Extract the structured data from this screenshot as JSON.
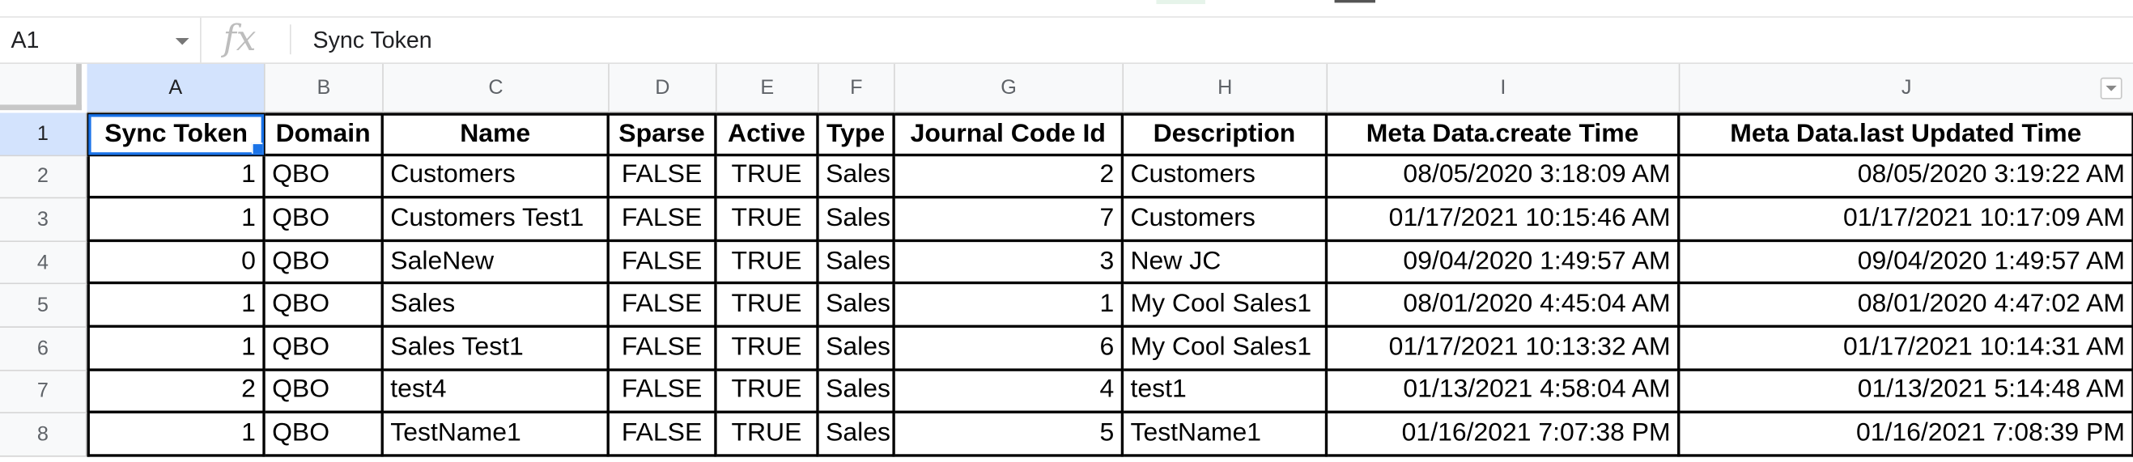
{
  "name_box": {
    "value": "A1"
  },
  "formula_bar": {
    "fx": "fx",
    "value": "Sync Token"
  },
  "columns": [
    "A",
    "B",
    "C",
    "D",
    "E",
    "F",
    "G",
    "H",
    "I",
    "J"
  ],
  "rows": [
    "1",
    "2",
    "3",
    "4",
    "5",
    "6",
    "7",
    "8"
  ],
  "table": {
    "headers": [
      "Sync Token",
      "Domain",
      "Name",
      "Sparse",
      "Active",
      "Type",
      "Journal Code Id",
      "Description",
      "Meta Data.create Time",
      "Meta Data.last Updated Time"
    ],
    "data": [
      [
        "1",
        "QBO",
        "Customers",
        "FALSE",
        "TRUE",
        "Sales",
        "2",
        "Customers",
        "08/05/2020 3:18:09 AM",
        "08/05/2020 3:19:22 AM"
      ],
      [
        "1",
        "QBO",
        "Customers Test1",
        "FALSE",
        "TRUE",
        "Sales",
        "7",
        "Customers",
        "01/17/2021 10:15:46 AM",
        "01/17/2021 10:17:09 AM"
      ],
      [
        "0",
        "QBO",
        "SaleNew",
        "FALSE",
        "TRUE",
        "Sales",
        "3",
        "New JC",
        "09/04/2020 1:49:57 AM",
        "09/04/2020 1:49:57 AM"
      ],
      [
        "1",
        "QBO",
        "Sales",
        "FALSE",
        "TRUE",
        "Sales",
        "1",
        "My Cool Sales1",
        "08/01/2020 4:45:04 AM",
        "08/01/2020 4:47:02 AM"
      ],
      [
        "1",
        "QBO",
        "Sales Test1",
        "FALSE",
        "TRUE",
        "Sales",
        "6",
        "My Cool Sales1",
        "01/17/2021 10:13:32 AM",
        "01/17/2021 10:14:31 AM"
      ],
      [
        "2",
        "QBO",
        "test4",
        "FALSE",
        "TRUE",
        "Sales",
        "4",
        "test1",
        "01/13/2021 4:58:04 AM",
        "01/13/2021 5:14:48 AM"
      ],
      [
        "1",
        "QBO",
        "TestName1",
        "FALSE",
        "TRUE",
        "Sales",
        "5",
        "TestName1",
        "01/16/2021 7:07:38 PM",
        "01/16/2021 7:08:39 PM"
      ]
    ]
  },
  "colors": {
    "selection": "#1a73e8",
    "header_selected_bg": "#d3e3fd",
    "header_bg": "#f8f9fa"
  },
  "icons": {
    "fx": "fx-icon",
    "filter": "filter-dropdown-icon",
    "name_box_dropdown": "chevron-down-icon"
  }
}
